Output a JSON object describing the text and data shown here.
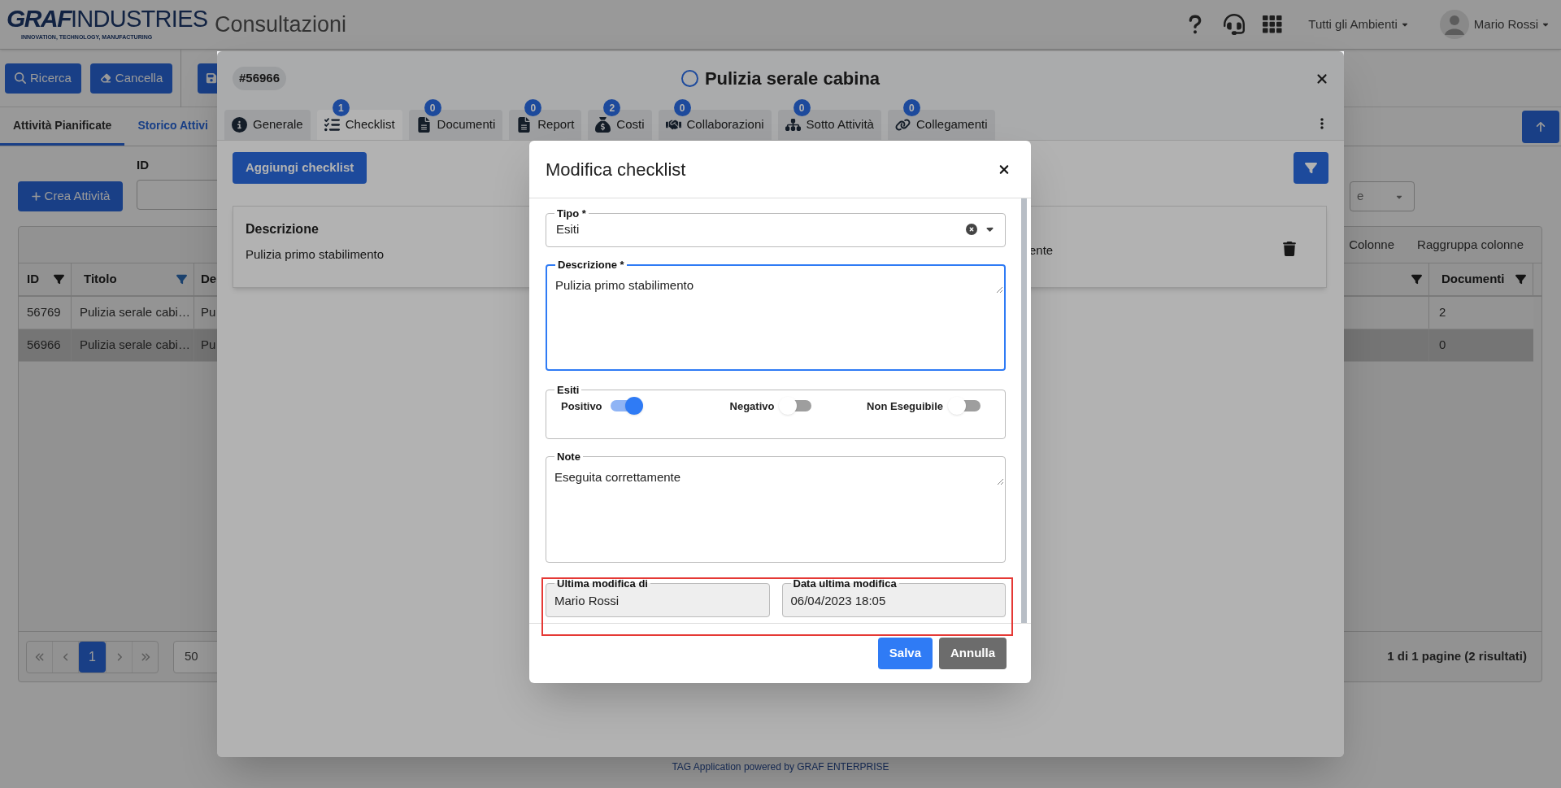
{
  "header": {
    "logo": {
      "mark": "GRAF",
      "word": "INDUSTRIES",
      "tagline": "INNOVATION, TECHNOLOGY, MANUFACTURING"
    },
    "title": "Consultazioni",
    "environment": "Tutti gli Ambienti",
    "user": "Mario Rossi"
  },
  "toolbar": {
    "buttons": [
      {
        "label": "Ricerca"
      },
      {
        "label": "Cancella"
      }
    ]
  },
  "page_tabs": [
    {
      "label": "Attività Pianificate",
      "selected": true
    },
    {
      "label": "Storico Attivi",
      "selected": false
    }
  ],
  "filters": {
    "id_label": "ID",
    "create_button": "Crea Attività",
    "select_value": "e"
  },
  "table": {
    "actions": [
      "Colonne",
      "Raggruppa colonne"
    ],
    "left_columns": [
      {
        "label": "ID",
        "filter_active": false
      },
      {
        "label": "Titolo",
        "filter_active": true
      },
      {
        "label": "De"
      }
    ],
    "right_columns": [
      {
        "filter_active": false
      },
      {
        "label": "Documenti",
        "filter_active": false
      }
    ],
    "rows": [
      {
        "id": "56769",
        "title": "Pulizia serale cabi…",
        "column_3": "Pu",
        "documenti": "2",
        "selected": false
      },
      {
        "id": "56966",
        "title": "Pulizia serale cabi…",
        "column_3": "Pu",
        "documenti": "0",
        "selected": true
      }
    ],
    "pagination": {
      "pages": [
        {
          "label": "1",
          "selected": true
        }
      ],
      "page_size": "50",
      "summary": "1 di 1 pagine (2 risultati)"
    }
  },
  "footer": "TAG Application powered by GRAF ENTERPRISE",
  "activity_modal": {
    "id": "#56966",
    "title": "Pulizia serale cabina",
    "tabs": [
      {
        "label": "Generale",
        "selected": false
      },
      {
        "label": "Checklist",
        "count": "1",
        "selected": true
      },
      {
        "label": "Documenti",
        "count": "0",
        "selected": false
      },
      {
        "label": "Report",
        "count": "0",
        "selected": false
      },
      {
        "label": "Costi",
        "count": "2",
        "selected": false
      },
      {
        "label": "Collaborazioni",
        "count": "0",
        "selected": false
      },
      {
        "label": "Sotto Attività",
        "count": "0",
        "selected": false
      },
      {
        "label": "Collegamenti",
        "count": "0",
        "selected": false
      }
    ],
    "add_button": "Aggiungi checklist",
    "card": {
      "heading": "Descrizione",
      "description": "Pulizia primo stabilimento",
      "column_2": "ente"
    }
  },
  "checklist_dialog": {
    "title": "Modifica checklist",
    "fields": [
      {
        "kind": "select",
        "label": "Tipo *",
        "value": "Esiti",
        "focused": false
      },
      {
        "kind": "textarea",
        "label": "Descrizione *",
        "value": "Pulizia primo stabilimento",
        "focused": true
      },
      {
        "kind": "toggles",
        "label": "Esiti",
        "toggles": [
          {
            "label": "Positivo",
            "on": true
          },
          {
            "label": "Negativo",
            "on": false
          },
          {
            "label": "Non Eseguibile",
            "on": false
          }
        ]
      },
      {
        "kind": "textarea",
        "label": "Note",
        "value": "Eseguita correttamente",
        "focused": false
      }
    ],
    "audit": [
      {
        "label": "Ultima modifica di",
        "value": "Mario Rossi"
      },
      {
        "label": "Data ultima modifica",
        "value": "06/04/2023 18:05"
      }
    ],
    "buttons": [
      {
        "label": "Salva",
        "kind": "primary"
      },
      {
        "label": "Annulla",
        "kind": "secondary"
      }
    ]
  }
}
